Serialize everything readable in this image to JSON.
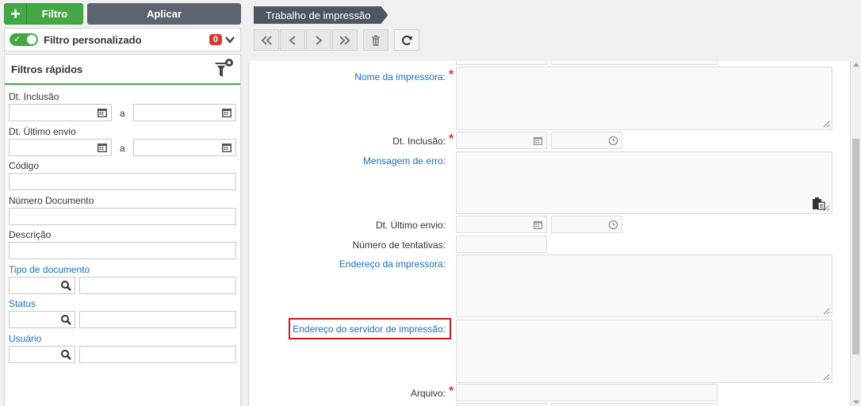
{
  "toolbar": {
    "filter_button": "Filtro",
    "apply_button": "Aplicar"
  },
  "custom_filter": {
    "label": "Filtro personalizado",
    "count": "0",
    "toggle_on": true
  },
  "quick_filters": {
    "title": "Filtros rápidos",
    "dt_inclusao": "Dt. Inclusão",
    "dt_ultimo_envio": "Dt. Último envio",
    "range_sep": "a",
    "codigo": "Código",
    "numero_documento": "Número Documento",
    "descricao": "Descrição",
    "tipo_documento": "Tipo de documento",
    "status": "Status",
    "usuario": "Usuário"
  },
  "breadcrumb": "Trabalho de impressão",
  "nav_icons": [
    "first-icon",
    "prev-icon",
    "next-icon",
    "last-icon",
    "trash-icon",
    "refresh-icon"
  ],
  "form": {
    "nome_impressora": "Nome da impressora:",
    "dt_inclusao": "Dt. Inclusão:",
    "mensagem_erro": "Mensagem de erro:",
    "dt_ultimo_envio": "Dt. Último envio:",
    "numero_tentativas": "Número de tentativas:",
    "endereco_impressora": "Endereço da impressora:",
    "endereco_servidor": "Endereço do servidor de impressão:",
    "arquivo": "Arquivo:",
    "required_mark": "*"
  },
  "colors": {
    "accent_green": "#43a843",
    "dark_button": "#5c6470",
    "link_blue": "#1a6fbf",
    "required_red": "#d9382c",
    "highlight_red": "#d0191f"
  }
}
